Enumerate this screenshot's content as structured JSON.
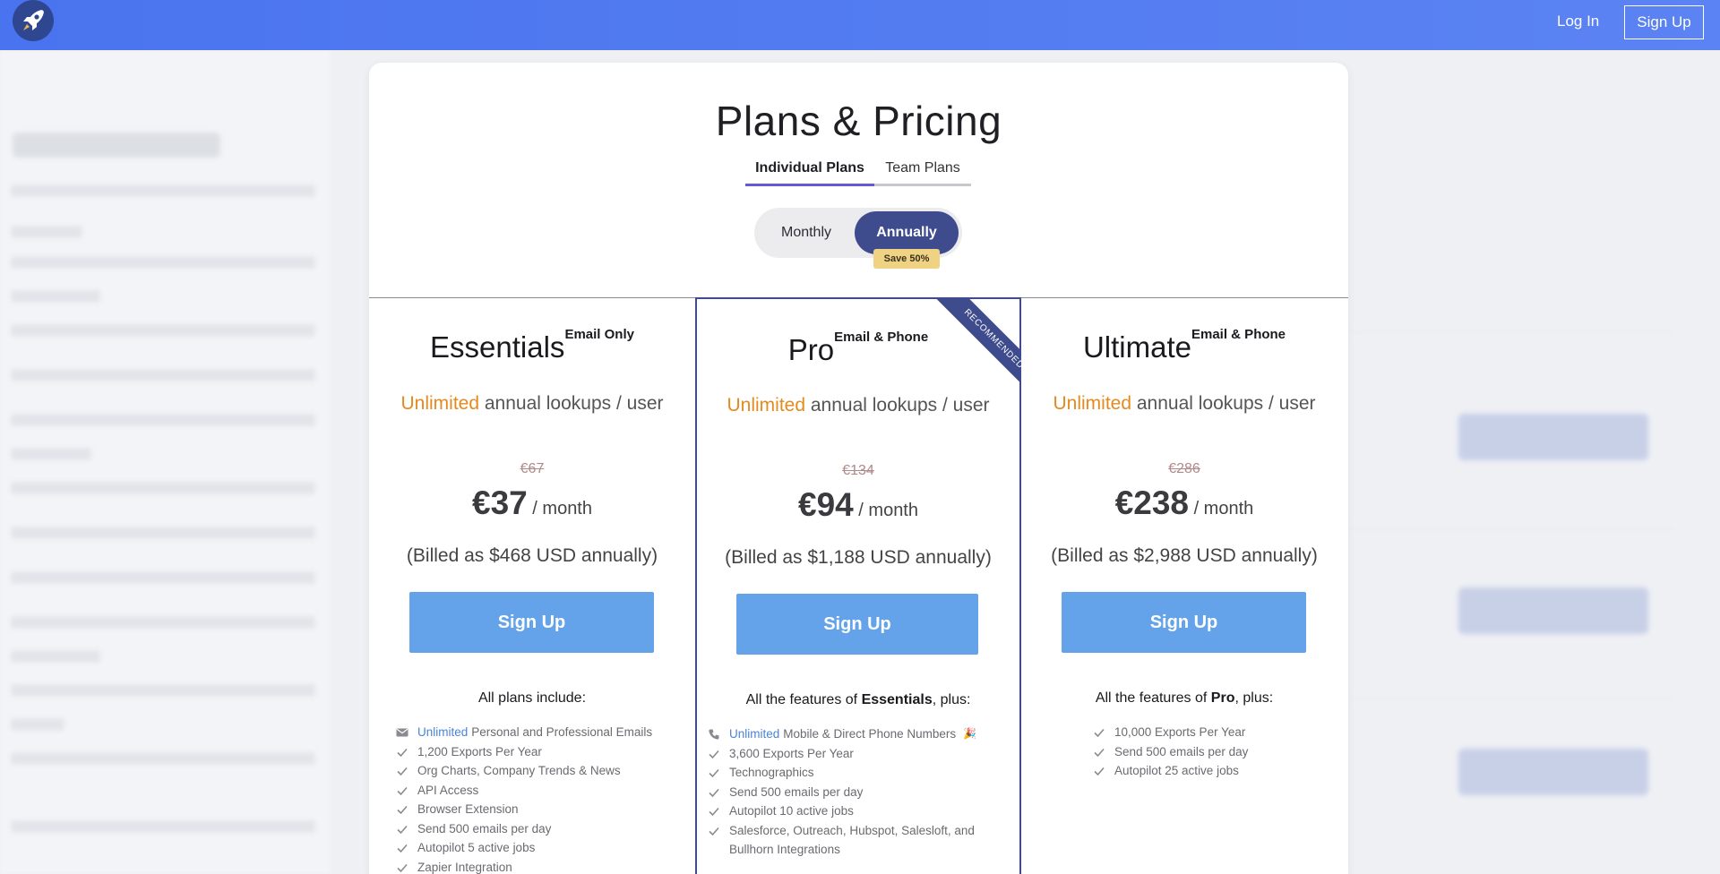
{
  "header": {
    "login_label": "Log In",
    "signup_label": "Sign Up"
  },
  "modal": {
    "title": "Plans & Pricing",
    "tabs": [
      {
        "label": "Individual Plans",
        "active": true
      },
      {
        "label": "Team Plans",
        "active": false
      }
    ],
    "billing": {
      "monthly_label": "Monthly",
      "annually_label": "Annually",
      "selected": "Annually",
      "save_badge": "Save 50%"
    }
  },
  "plans": [
    {
      "name": "Essentials",
      "tag": "Email Only",
      "lookups_accent": "Unlimited",
      "lookups_text": " annual lookups / user",
      "old_price": "€67",
      "price": "€37",
      "per": " / month",
      "billed": "(Billed as $468 USD annually)",
      "signup_label": "Sign Up",
      "features_heading": "All plans include:",
      "features": [
        {
          "icon": "envelope-icon",
          "highlight": "Unlimited",
          "text": "Personal and Professional Emails"
        },
        {
          "icon": "check-icon",
          "text": "1,200 Exports Per Year"
        },
        {
          "icon": "check-icon",
          "text": "Org Charts, Company Trends & News"
        },
        {
          "icon": "check-icon",
          "text": "API Access"
        },
        {
          "icon": "check-icon",
          "text": "Browser Extension"
        },
        {
          "icon": "check-icon",
          "text": "Send 500 emails per day"
        },
        {
          "icon": "check-icon",
          "text": "Autopilot 5 active jobs"
        },
        {
          "icon": "check-icon",
          "text": "Zapier Integration"
        }
      ]
    },
    {
      "name": "Pro",
      "tag": "Email & Phone",
      "ribbon": "RECOMMENDED",
      "lookups_accent": "Unlimited",
      "lookups_text": " annual lookups / user",
      "old_price": "€134",
      "price": "€94",
      "per": " / month",
      "billed": "(Billed as $1,188 USD annually)",
      "signup_label": "Sign Up",
      "features_heading_prefix": "All the features of ",
      "features_heading_bold": "Essentials",
      "features_heading_suffix": ", plus:",
      "features": [
        {
          "icon": "phone-icon",
          "highlight": "Unlimited",
          "text": "Mobile & Direct Phone Numbers",
          "extra": "🎉"
        },
        {
          "icon": "check-icon",
          "text": "3,600 Exports Per Year"
        },
        {
          "icon": "check-icon",
          "text": "Technographics"
        },
        {
          "icon": "check-icon",
          "text": "Send 500 emails per day"
        },
        {
          "icon": "check-icon",
          "text": "Autopilot 10 active jobs"
        },
        {
          "icon": "check-icon",
          "text": "Salesforce, Outreach, Hubspot, Salesloft, and Bullhorn Integrations"
        }
      ]
    },
    {
      "name": "Ultimate",
      "tag": "Email & Phone",
      "lookups_accent": "Unlimited",
      "lookups_text": " annual lookups / user",
      "old_price": "€286",
      "price": "€238",
      "per": " / month",
      "billed": "(Billed as $2,988 USD annually)",
      "signup_label": "Sign Up",
      "features_heading_prefix": "All the features of ",
      "features_heading_bold": "Pro",
      "features_heading_suffix": ", plus:",
      "features": [
        {
          "icon": "check-icon",
          "text": "10,000 Exports Per Year"
        },
        {
          "icon": "check-icon",
          "text": "Send 500 emails per day"
        },
        {
          "icon": "check-icon",
          "text": "Autopilot 25 active jobs"
        }
      ]
    }
  ],
  "colors": {
    "header": "#4a74ef",
    "accent_orange": "#e48a1e",
    "toggle_active": "#3e4c8e",
    "signup_button": "#64a3ea",
    "save_badge": "#efd282"
  }
}
